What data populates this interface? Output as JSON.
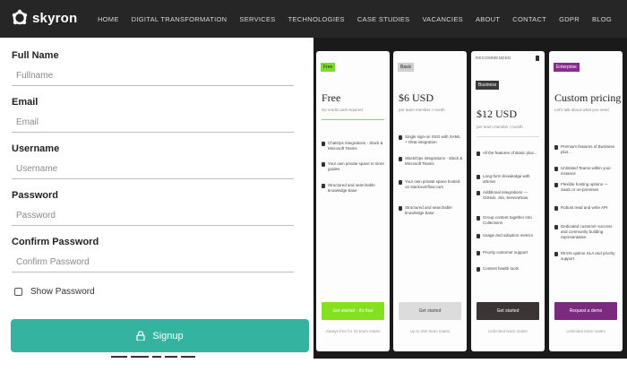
{
  "brand": {
    "name": "skyron"
  },
  "nav": [
    "HOME",
    "DIGITAL TRANSFORMATION",
    "SERVICES",
    "TECHNOLOGIES",
    "CASE STUDIES",
    "VACANCIES",
    "ABOUT",
    "CONTACT",
    "GDPR",
    "BLOG"
  ],
  "form": {
    "fields": [
      {
        "label": "Full Name",
        "placeholder": "Fullname"
      },
      {
        "label": "Email",
        "placeholder": "Email"
      },
      {
        "label": "Username",
        "placeholder": "Username"
      },
      {
        "label": "Password",
        "placeholder": "Password"
      },
      {
        "label": "Confirm Password",
        "placeholder": "Confirm Password"
      }
    ],
    "show_password_label": "Show Password",
    "signup_label": "Signup"
  },
  "pricing": {
    "plans": [
      {
        "badge": "Free",
        "badge_color": "#7ddb2a",
        "name": "Free",
        "subtitle": "No credit card required",
        "features": [
          "ChatOps integrations - Slack & Microsoft Teams",
          "Your own private space to store guides",
          "Structured and searchable knowledge base"
        ],
        "cta": "Get started - it's free",
        "cta_bg": "#84e11f",
        "cta_color": "#ffffff",
        "note": "Always free for 20 team mates"
      },
      {
        "badge": "Basic",
        "badge_color": "#cfcfcf",
        "name": "$6 USD",
        "subtitle": "per team member / month",
        "features": [
          "Single sign-on SSO with SAML + Okta integration",
          "Slack/Ops integrations - Slack & Microsoft Teams",
          "Your own private space hosted on stackoverflow.com",
          "Structured and searchable knowledge base"
        ],
        "cta": "Get started",
        "cta_bg": "#dcdcdc",
        "cta_color": "#444444",
        "note": "Up to 250 team mates"
      },
      {
        "recommended": "RECOMMENDED",
        "badge": "Business",
        "badge_color": "#3a3a3a",
        "name": "$12 USD",
        "subtitle": "per team member / month",
        "features": [
          "All the features of Basic plus...",
          "Long-form knowledge with articles",
          "Additional integrations — GitHub, Jira, ServiceNow",
          "Group content together into Collections",
          "Usage and adoption metrics",
          "Priority customer support",
          "Content health tools"
        ],
        "cta": "Get started",
        "cta_bg": "#3a3434",
        "cta_color": "#ffffff",
        "note": "Unlimited team mates"
      },
      {
        "badge": "Enterprise",
        "badge_color": "#8a2a8e",
        "name": "Custom pricing",
        "subtitle": "Let's talk about what you need",
        "features": [
          "Premium features of Business plus...",
          "Unlimited Teams within your instance",
          "Flexible hosting options — SaaS or on-premises",
          "Robust read and write API",
          "Dedicated customer success and community building representative",
          "99.5% uptime SLA and priority support"
        ],
        "cta": "Request a demo",
        "cta_bg": "#7a2b80",
        "cta_color": "#ffffff",
        "note": "Unlimited team mates"
      }
    ]
  }
}
